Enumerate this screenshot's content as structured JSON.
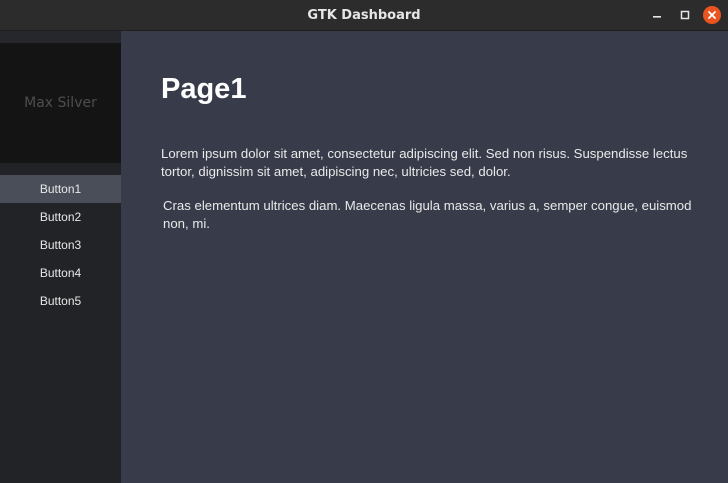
{
  "window": {
    "title": "GTK Dashboard"
  },
  "sidebar": {
    "profile_name": "Max Silver",
    "items": [
      {
        "label": "Button1"
      },
      {
        "label": "Button2"
      },
      {
        "label": "Button3"
      },
      {
        "label": "Button4"
      },
      {
        "label": "Button5"
      }
    ]
  },
  "main": {
    "title": "Page1",
    "paragraph1": "Lorem ipsum dolor sit amet, consectetur adipiscing elit. Sed non risus. Suspendisse lectus tortor, dignissim sit amet, adipiscing nec, ultricies sed, dolor.",
    "paragraph2": "Cras elementum ultrices diam. Maecenas ligula massa, varius a, semper congue, euismod non, mi."
  },
  "colors": {
    "close_button": "#e95420",
    "active_item": "#4a4e59",
    "main_bg": "#383c4a",
    "sidebar_bg": "#222327"
  },
  "icons": {
    "minimize": "minimize-icon",
    "maximize": "maximize-icon",
    "close": "close-icon"
  }
}
